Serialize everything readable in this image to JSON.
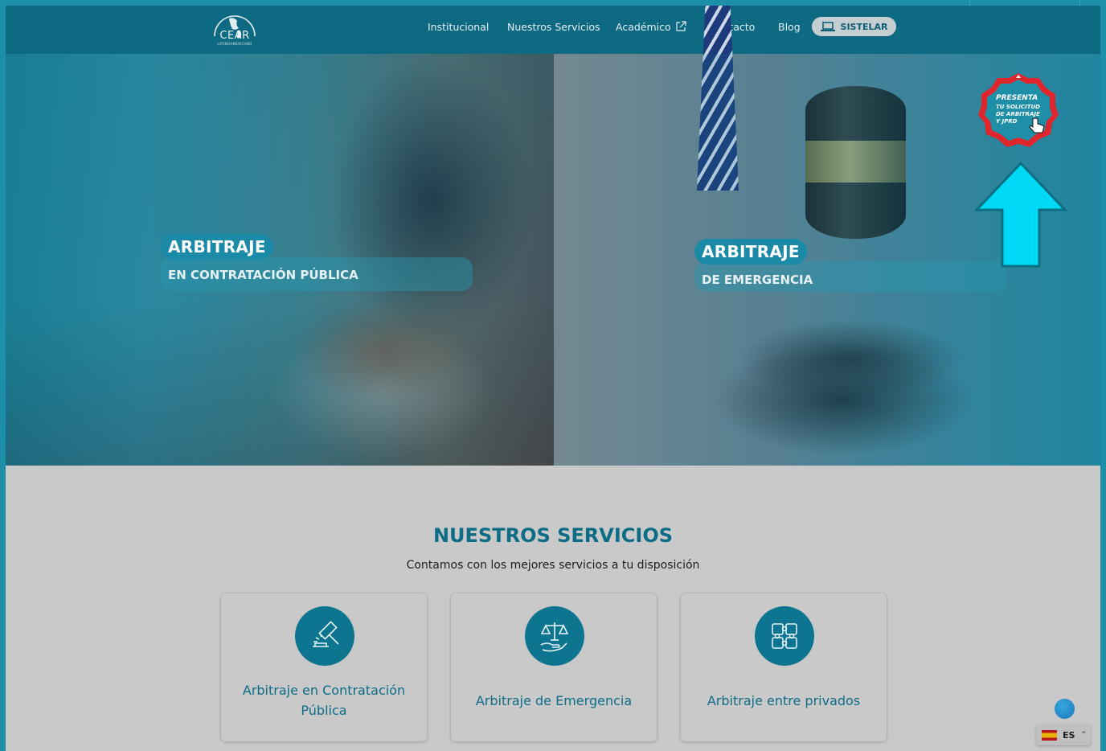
{
  "header": {
    "logo_text": "CEAR",
    "logo_sub": "LATINOAMERICANO",
    "nav": [
      {
        "label": "Institucional"
      },
      {
        "label": "Nuestros Servicios"
      },
      {
        "label": "Académico"
      },
      {
        "label": "Contacto"
      },
      {
        "label": "Blog"
      }
    ],
    "sistelar_label": "SISTELAR"
  },
  "hero": {
    "left": {
      "title": "ARBITRAJE",
      "subtitle": "EN CONTRATACIÓN PÚBLICA"
    },
    "right": {
      "title": "ARBITRAJE",
      "subtitle": "DE EMERGENCIA"
    },
    "badge": {
      "line1": "PRESENTA",
      "line2": "TU SOLICITUD",
      "line3": "DE ARBITRAJE",
      "line4": "Y JPRD"
    }
  },
  "services": {
    "title": "NUESTROS SERVICIOS",
    "subtitle": "Contamos con los mejores servicios a tu disposición",
    "cards": [
      {
        "label": "Arbitraje en Contratación Pública",
        "icon": "gavel-icon"
      },
      {
        "label": "Arbitraje de Emergencia",
        "icon": "scales-hand-icon"
      },
      {
        "label": "Arbitraje entre privados",
        "icon": "puzzle-icon"
      }
    ]
  },
  "language": {
    "code": "ES"
  },
  "colors": {
    "primary": "#0e6982",
    "accent": "#0d6d87",
    "arrow": "#00d9f5",
    "badge_border": "#e0262d"
  }
}
